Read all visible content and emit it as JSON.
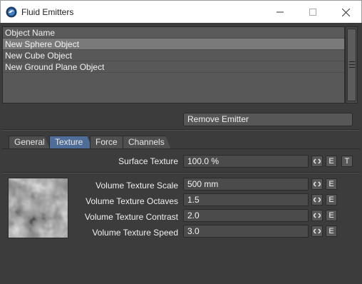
{
  "window": {
    "title": "Fluid Emitters",
    "minimize_glyph": "—",
    "maximize_glyph": "☐",
    "close_glyph": "✕"
  },
  "object_list": {
    "header": "Object Name",
    "items": [
      "New Sphere Object",
      "New Cube Object",
      "New Ground Plane Object"
    ],
    "selected_index": 0
  },
  "remove_button": "Remove Emitter",
  "tabs": [
    {
      "label": "General",
      "active": false
    },
    {
      "label": "Texture",
      "active": true
    },
    {
      "label": "Force",
      "active": false
    },
    {
      "label": "Channels",
      "active": false
    }
  ],
  "surface_texture": {
    "label": "Surface Texture",
    "value": "100.0 %",
    "envelope_glyph": "◇",
    "e_label": "E",
    "t_label": "T"
  },
  "volume_params": [
    {
      "label": "Volume Texture Scale",
      "value": "500 mm",
      "e_label": "E"
    },
    {
      "label": "Volume Texture Octaves",
      "value": "1.5",
      "e_label": "E"
    },
    {
      "label": "Volume Texture Contrast",
      "value": "2.0",
      "e_label": "E"
    },
    {
      "label": "Volume Texture Speed",
      "value": "3.0",
      "e_label": "E"
    }
  ],
  "colors": {
    "panel_bg": "#3c3c3c",
    "active_tab": "#4f6d99",
    "selected_row": "#7a7a7a"
  }
}
